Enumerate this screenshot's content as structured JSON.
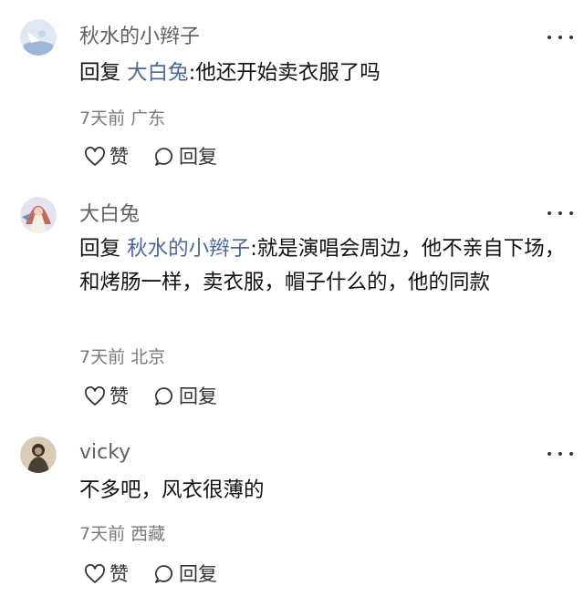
{
  "comments": [
    {
      "username": "秋水的小辫子",
      "reply_prefix": "回复",
      "reply_target": "大白兔",
      "separator": ":",
      "text": "他还开始卖衣服了吗",
      "time": "7天前",
      "location": "广东",
      "like_label": "赞",
      "reply_label": "回复"
    },
    {
      "username": "大白兔",
      "reply_prefix": "回复",
      "reply_target": "秋水的小辫子",
      "separator": ":",
      "text": "就是演唱会周边，他不亲自下场，和烤肠一样，卖衣服，帽子什么的，他的同款",
      "time": "7天前",
      "location": "北京",
      "like_label": "赞",
      "reply_label": "回复"
    },
    {
      "username": "vicky",
      "text": "不多吧，风衣很薄的",
      "time": "7天前",
      "location": "西藏",
      "like_label": "赞",
      "reply_label": "回复"
    }
  ],
  "colors": {
    "username": "#606060",
    "reply_target": "#4a67a3",
    "meta": "#7a7a7a"
  }
}
